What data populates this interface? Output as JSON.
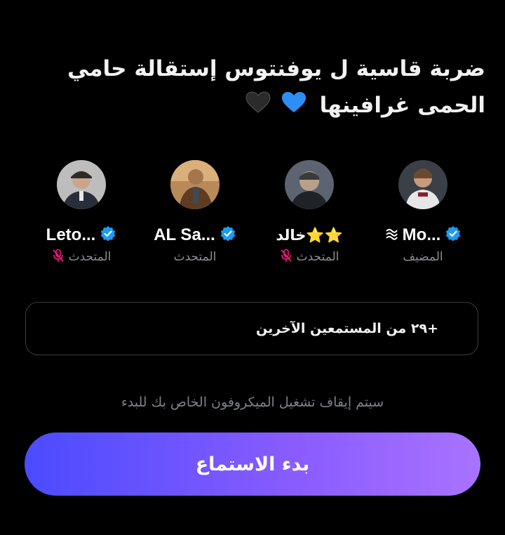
{
  "space": {
    "title": "ضربة قاسية ل يوفنتوس إستقالة حامي الحمى غرافينها",
    "title_emoji": [
      "blue-heart",
      "black-heart"
    ]
  },
  "speakers": [
    {
      "name": "Mo...",
      "role": "المضيف",
      "verified": true,
      "muted": false,
      "badge": "wavy-lines-icon",
      "avatar_colors": [
        "#d8d8d8",
        "#8a1f2b"
      ]
    },
    {
      "name": "خالد⭐⭐",
      "role": "المتحدث",
      "verified": false,
      "muted": true,
      "badge": "",
      "avatar_colors": [
        "#4a5058",
        "#1f2328"
      ]
    },
    {
      "name": "AL Sa...",
      "role": "المتحدث",
      "verified": true,
      "muted": false,
      "badge": "",
      "avatar_colors": [
        "#c08a4e",
        "#5e3b23"
      ]
    },
    {
      "name": "Leto...",
      "role": "المتحدث",
      "verified": true,
      "muted": true,
      "badge": "",
      "avatar_colors": [
        "#9a9a9a",
        "#2a2e3a"
      ]
    }
  ],
  "listeners": {
    "label": "+٢٩ من المستمعين الآخرين"
  },
  "mic_note": "سيتم إيقاف تشغيل الميكروفون الخاص بك للبدء",
  "start_button": {
    "label": "بدء الاستماع"
  },
  "colors": {
    "background": "#000000",
    "verified_blue": "#1d9bf0",
    "muted_pink": "#f91880",
    "button_gradient_start": "#4b4bff",
    "button_gradient_end": "#a873ff"
  }
}
